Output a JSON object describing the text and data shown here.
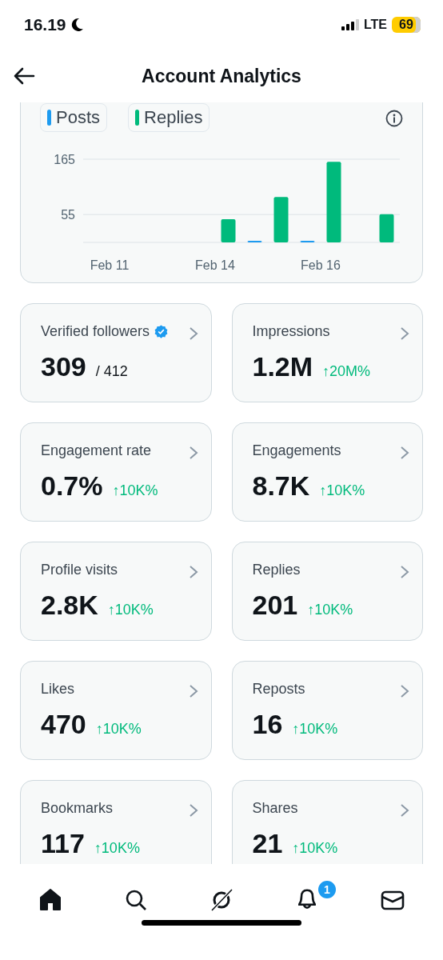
{
  "status_bar": {
    "time": "16.19",
    "network": "LTE",
    "battery": "69"
  },
  "header": {
    "title": "Account Analytics"
  },
  "chart_card": {
    "chart_data": {
      "type": "bar",
      "categories": [
        "Feb 11",
        null,
        "Feb 14",
        null,
        "Feb 16",
        null
      ],
      "series": [
        {
          "name": "Posts",
          "color": "#1d9bf0",
          "values": [
            0,
            0,
            0,
            2,
            2,
            0
          ]
        },
        {
          "name": "Replies",
          "color": "#00ba7c",
          "values": [
            0,
            0,
            46,
            90,
            160,
            56
          ]
        }
      ],
      "ylim": [
        0,
        165
      ],
      "yticks": [
        55,
        165
      ]
    }
  },
  "metrics": [
    {
      "label": "Verified followers",
      "verified": true,
      "value": "309",
      "kind": "ratio",
      "extra": "/ 412"
    },
    {
      "label": "Impressions",
      "verified": false,
      "value": "1.2M",
      "kind": "change",
      "extra": "↑20M%"
    },
    {
      "label": "Engagement rate",
      "verified": false,
      "value": "0.7%",
      "kind": "change",
      "extra": "↑10K%"
    },
    {
      "label": "Engagements",
      "verified": false,
      "value": "8.7K",
      "kind": "change",
      "extra": "↑10K%"
    },
    {
      "label": "Profile visits",
      "verified": false,
      "value": "2.8K",
      "kind": "change",
      "extra": "↑10K%"
    },
    {
      "label": "Replies",
      "verified": false,
      "value": "201",
      "kind": "change",
      "extra": "↑10K%"
    },
    {
      "label": "Likes",
      "verified": false,
      "value": "470",
      "kind": "change",
      "extra": "↑10K%"
    },
    {
      "label": "Reposts",
      "verified": false,
      "value": "16",
      "kind": "change",
      "extra": "↑10K%"
    },
    {
      "label": "Bookmarks",
      "verified": false,
      "value": "117",
      "kind": "change",
      "extra": "↑10K%"
    },
    {
      "label": "Shares",
      "verified": false,
      "value": "21",
      "kind": "change",
      "extra": "↑10K%"
    }
  ],
  "tab_bar": [
    {
      "kind": "home",
      "selected": true
    },
    {
      "kind": "search",
      "selected": false
    },
    {
      "kind": "grok",
      "selected": false
    },
    {
      "kind": "bell",
      "selected": false,
      "badge": "1"
    },
    {
      "kind": "mail",
      "selected": false
    }
  ]
}
